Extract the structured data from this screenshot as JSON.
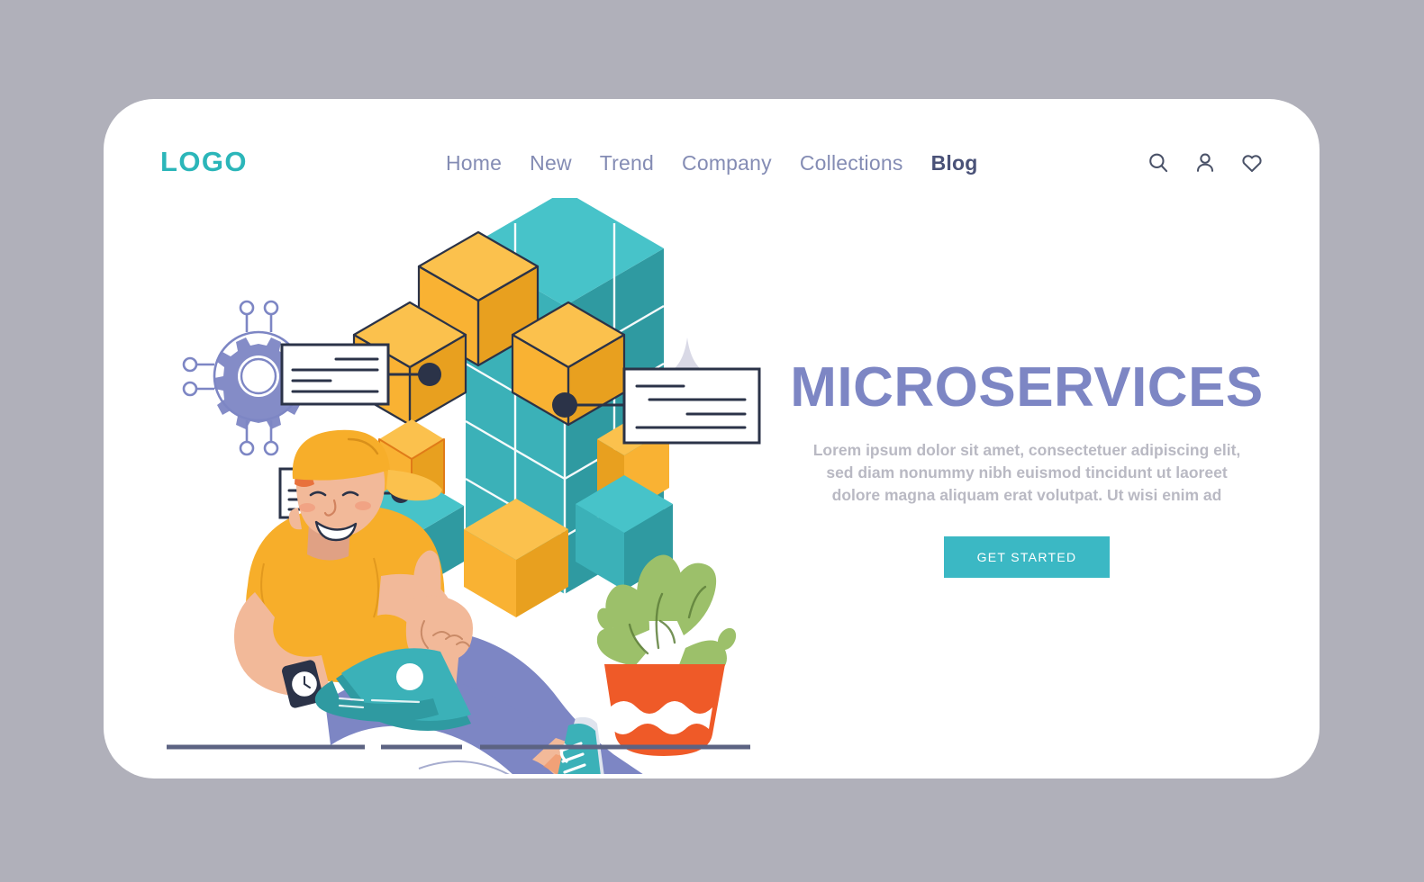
{
  "page": {
    "background_color": "#b0b0ba",
    "card_color": "#ffffff"
  },
  "header": {
    "logo": "LOGO",
    "logo_color": "#2bb6b9",
    "nav": [
      {
        "label": "Home",
        "active": false
      },
      {
        "label": "New",
        "active": false
      },
      {
        "label": "Trend",
        "active": false
      },
      {
        "label": "Company",
        "active": false
      },
      {
        "label": "Collections",
        "active": false
      },
      {
        "label": "Blog",
        "active": true
      }
    ],
    "icons": [
      {
        "name": "search-icon"
      },
      {
        "name": "user-icon"
      },
      {
        "name": "heart-icon"
      }
    ]
  },
  "hero": {
    "title": "MICROSERVICES",
    "title_color": "#7d86c4",
    "paragraph": "Lorem ipsum dolor sit amet, consectetuer adipiscing elit, sed diam nonummy nibh euismod tincidunt ut laoreet dolore magna aliquam erat volutpat. Ut wisi enim ad",
    "paragraph_color": "#b9b9c3",
    "cta_label": "GET STARTED",
    "cta_color": "#3bb8c4"
  },
  "illustration": {
    "name": "developer-with-laptop-and-microservice-cubes",
    "colors": {
      "teal": "#3bb1b8",
      "teal_dark": "#2f9aa1",
      "orange": "#f9b233",
      "orange_dark": "#e8a01f",
      "periwinkle": "#7d86c4",
      "periwinkle_dark": "#6b73b0",
      "skin": "#f2b999",
      "skin_dark": "#e0a184",
      "shirt": "#f7ae2a",
      "hair": "#e8713c",
      "plant_green": "#9cc06a",
      "plant_green_dark": "#7fa84f",
      "pot_orange": "#ef5a28",
      "ink": "#2b3348",
      "sparkle": "#d9d9e6",
      "ground": "#5c6382"
    },
    "elements": [
      {
        "name": "gear-network-icon"
      },
      {
        "name": "isometric-cube-cluster"
      },
      {
        "name": "callout-card-left"
      },
      {
        "name": "callout-card-right"
      },
      {
        "name": "callout-card-lower"
      },
      {
        "name": "person-with-laptop"
      },
      {
        "name": "potted-plant"
      },
      {
        "name": "sparkle-decoration"
      },
      {
        "name": "ground-line"
      }
    ]
  }
}
